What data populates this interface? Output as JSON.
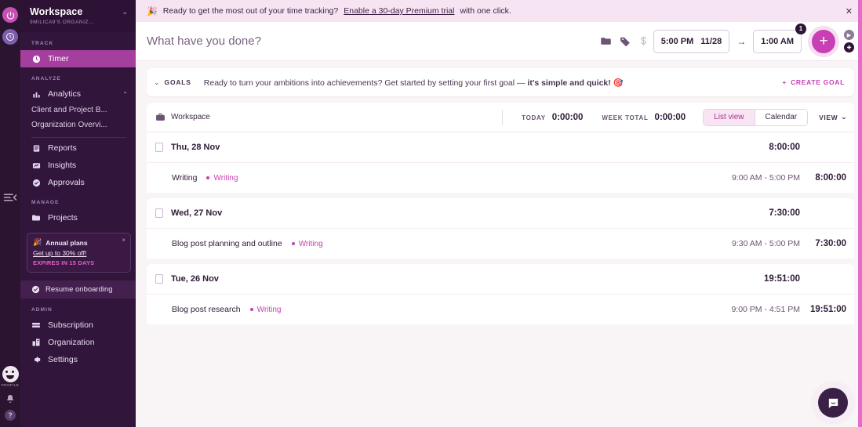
{
  "rail": {
    "pomodoro_icon": "power-icon",
    "clock_icon": "clock-icon",
    "collapse_icon": "sidebar-collapse-icon",
    "profile_label": "PROFILE",
    "bell_icon": "bell-icon",
    "help_label": "?"
  },
  "sidebar": {
    "workspace_title": "Workspace",
    "workspace_subtitle": "9MILICA9'S ORGANIZ...",
    "caret": "⌄",
    "sections": [
      {
        "label": "TRACK"
      },
      {
        "label": "ANALYZE"
      },
      {
        "label": "MANAGE"
      },
      {
        "label": "ADMIN"
      }
    ],
    "track_items": [
      {
        "label": "Timer",
        "icon": "clock-icon",
        "active": true
      }
    ],
    "analyze_items": [
      {
        "label": "Analytics",
        "icon": "bar-chart-icon",
        "expanded": true
      },
      {
        "label": "Client and Project B...",
        "sub": true
      },
      {
        "label": "Organization Overvi...",
        "sub": true
      },
      {
        "label": "Reports",
        "icon": "reports-icon"
      },
      {
        "label": "Insights",
        "icon": "insights-icon"
      },
      {
        "label": "Approvals",
        "icon": "check-circle-icon"
      }
    ],
    "manage_items": [
      {
        "label": "Projects",
        "icon": "folder-icon"
      }
    ],
    "admin_items": [
      {
        "label": "Subscription",
        "icon": "card-icon"
      },
      {
        "label": "Organization",
        "icon": "building-icon"
      },
      {
        "label": "Settings",
        "icon": "gear-icon"
      }
    ],
    "promo": {
      "title": "Annual plans",
      "icon": "party-popper-icon",
      "close": "×",
      "link": "Get up to 30% off!",
      "expires": "EXPIRES IN 15 DAYS"
    },
    "resume": {
      "label": "Resume onboarding",
      "icon": "check-circle-icon"
    }
  },
  "banner": {
    "icon": "party-popper-icon",
    "text_before": "Ready to get the most out of your time tracking?",
    "link": "Enable a 30-day Premium trial",
    "text_after": "with one click.",
    "close": "✕"
  },
  "entrybar": {
    "placeholder": "What have you done?",
    "value": "",
    "icons": [
      "folder-icon",
      "tag-icon",
      "billable-icon"
    ],
    "start_time": "5:00 PM",
    "start_date": "11/28",
    "arrow": "→",
    "end_time": "1:00 AM",
    "day_badge": "1",
    "add_label": "+",
    "timer_mode_icon": "play-icon",
    "manual_mode_icon": "plus-icon"
  },
  "goals": {
    "caret": "⌄",
    "label": "GOALS",
    "message_plain": "Ready to turn your ambitions into achievements? Get started by setting your first goal — ",
    "message_bold": "it's simple and quick!",
    "emoji": "🎯",
    "create_label": "CREATE GOAL",
    "create_plus": "+"
  },
  "workspace_bar": {
    "icon": "briefcase-icon",
    "name": "Workspace",
    "today_label": "TODAY",
    "today_value": "0:00:00",
    "week_label": "WEEK TOTAL",
    "week_value": "0:00:00",
    "list_view_label": "List view",
    "calendar_label": "Calendar",
    "view_label": "VIEW",
    "view_caret": "⌄"
  },
  "days": [
    {
      "name": "Thu, 28 Nov",
      "total": "8:00:00",
      "entries": [
        {
          "name": "Writing",
          "tag": "Writing",
          "span": "9:00 AM - 5:00 PM",
          "total": "8:00:00"
        }
      ]
    },
    {
      "name": "Wed, 27 Nov",
      "total": "7:30:00",
      "entries": [
        {
          "name": "Blog post planning and outline",
          "tag": "Writing",
          "span": "9:30 AM - 5:00 PM",
          "total": "7:30:00"
        }
      ]
    },
    {
      "name": "Tue, 26 Nov",
      "total": "19:51:00",
      "entries": [
        {
          "name": "Blog post research",
          "tag": "Writing",
          "span": "9:00 PM - 4:51 PM",
          "total": "19:51:00"
        }
      ]
    }
  ],
  "chat": {
    "icon": "chat-bubble-icon"
  },
  "colors": {
    "accent": "#c93fb4",
    "sidebar_bg": "#32153b",
    "rail_bg": "#2a1430",
    "active_nav": "#a43f9e",
    "banner_bg": "#f7e4f3",
    "page_bg": "#f9f4f6",
    "edge_strip": "#e66bc9"
  }
}
